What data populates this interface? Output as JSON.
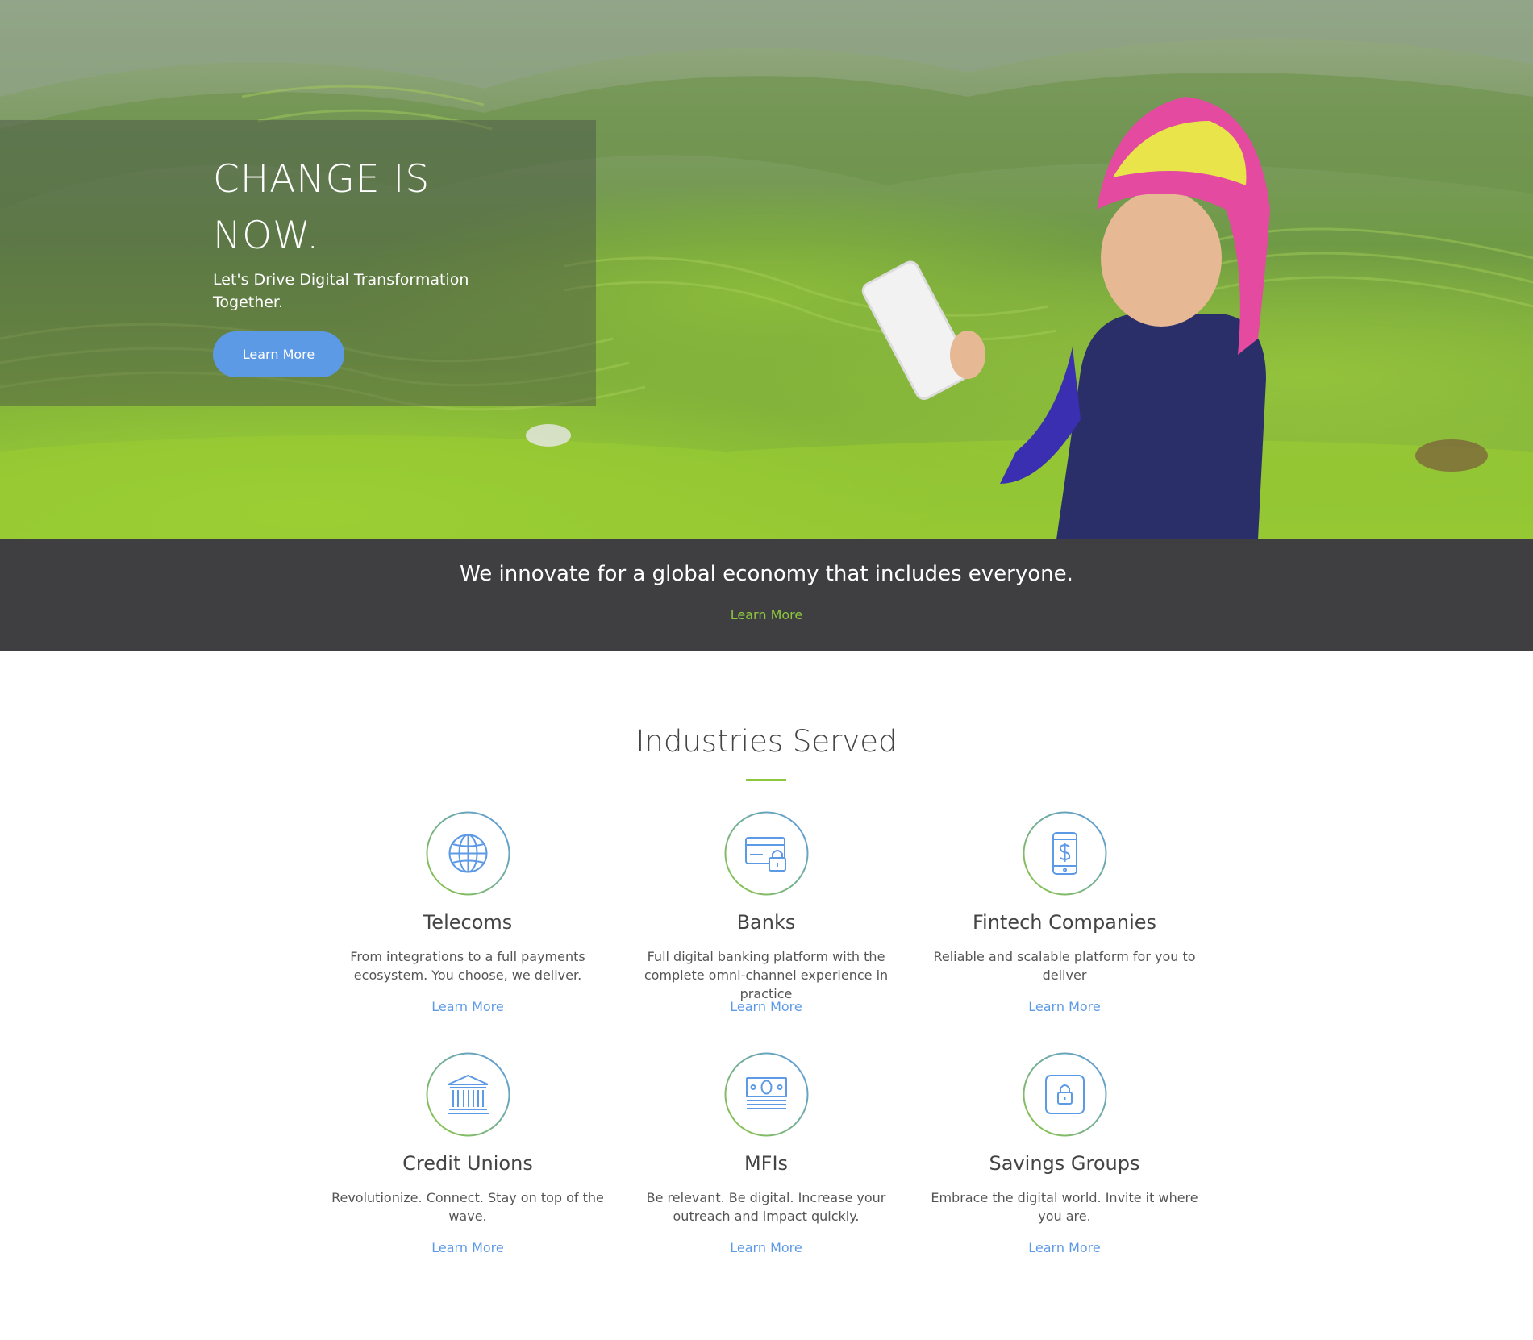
{
  "hero": {
    "title": "CHANGE IS NOW.",
    "subtitle": "Let's Drive Digital Transformation Together.",
    "button_label": "Learn More"
  },
  "band": {
    "text": "We innovate for a global economy that includes everyone.",
    "link_label": "Learn More"
  },
  "industries": {
    "title": "Industries Served",
    "items": [
      {
        "title": "Telecoms",
        "description": "From integrations to a full payments ecosystem. You choose, we deliver.",
        "link": "Learn More",
        "icon": "globe-icon"
      },
      {
        "title": "Banks",
        "description": "Full digital banking platform with the complete omni-channel experience in practice",
        "link": "Learn More",
        "icon": "card-lock-icon"
      },
      {
        "title": "Fintech Companies",
        "description": "Reliable and scalable platform for you to deliver",
        "link": "Learn More",
        "icon": "phone-dollar-icon"
      },
      {
        "title": "Credit Unions",
        "description": "Revolutionize. Connect. Stay on top of the wave.",
        "link": "Learn More",
        "icon": "bank-building-icon"
      },
      {
        "title": "MFIs",
        "description": "Be relevant. Be digital. Increase your outreach and impact quickly.",
        "link": "Learn More",
        "icon": "banknote-icon"
      },
      {
        "title": "Savings Groups",
        "description": "Embrace the digital world. Invite it where you are.",
        "link": "Learn More",
        "icon": "safe-lock-icon"
      }
    ]
  },
  "colors": {
    "accent_blue": "#5d9ae6",
    "accent_green": "#8dc63f",
    "band_bg": "#3f3f41"
  }
}
